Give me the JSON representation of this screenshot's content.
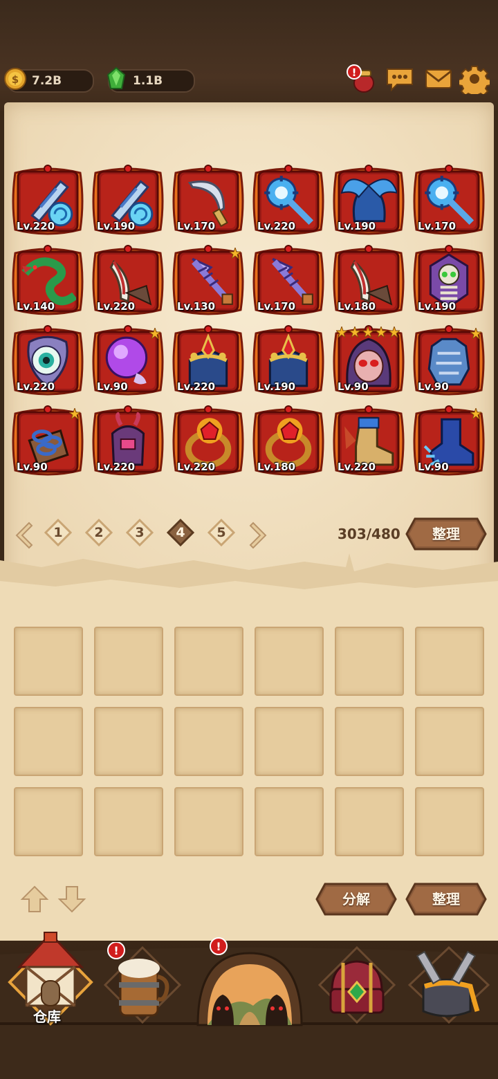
{
  "resources": {
    "gold": "7.2B",
    "gems": "1.1B"
  },
  "top_icons": [
    "quest-bag-icon",
    "chat-icon",
    "mail-icon",
    "settings-gear-icon"
  ],
  "equipment": {
    "items": [
      {
        "name": "sword",
        "level": "Lv.220",
        "stars": 0
      },
      {
        "name": "sword",
        "level": "Lv.190",
        "stars": 0
      },
      {
        "name": "scimitar",
        "level": "Lv.170",
        "stars": 0
      },
      {
        "name": "mace",
        "level": "Lv.220",
        "stars": 0
      },
      {
        "name": "helmet-wings",
        "level": "Lv.190",
        "stars": 0
      },
      {
        "name": "mace",
        "level": "Lv.170",
        "stars": 0
      },
      {
        "name": "serpent",
        "level": "Lv.140",
        "stars": 0
      },
      {
        "name": "claw-blade",
        "level": "Lv.220",
        "stars": 0
      },
      {
        "name": "spear",
        "level": "Lv.130",
        "stars": 1
      },
      {
        "name": "spear",
        "level": "Lv.170",
        "stars": 0
      },
      {
        "name": "claw-blade",
        "level": "Lv.180",
        "stars": 0
      },
      {
        "name": "skull-shield",
        "level": "Lv.190",
        "stars": 0
      },
      {
        "name": "eye-shield",
        "level": "Lv.220",
        "stars": 0
      },
      {
        "name": "orb",
        "level": "Lv.90",
        "stars": 1
      },
      {
        "name": "crown-helm",
        "level": "Lv.220",
        "stars": 0
      },
      {
        "name": "crown-helm",
        "level": "Lv.190",
        "stars": 0
      },
      {
        "name": "skull-hood",
        "level": "Lv.90",
        "stars": 5
      },
      {
        "name": "armor",
        "level": "Lv.90",
        "stars": 1
      },
      {
        "name": "chain-gloves",
        "level": "Lv.90",
        "stars": 1
      },
      {
        "name": "demon-gloves",
        "level": "Lv.220",
        "stars": 0
      },
      {
        "name": "fire-ring",
        "level": "Lv.220",
        "stars": 0
      },
      {
        "name": "fire-ring",
        "level": "Lv.180",
        "stars": 0
      },
      {
        "name": "boots",
        "level": "Lv.220",
        "stars": 0
      },
      {
        "name": "ice-boots",
        "level": "Lv.90",
        "stars": 1
      }
    ]
  },
  "pager": {
    "pages": [
      "1",
      "2",
      "3",
      "4",
      "5"
    ],
    "current": "4"
  },
  "capacity": "303/480",
  "buttons": {
    "sort_top": "整理",
    "dismantle": "分解",
    "sort_bottom": "整理"
  },
  "bottom_nav": {
    "warehouse_label": "仓库"
  },
  "colors": {
    "frame_red": "#b8231a",
    "frame_orange": "#e8701c",
    "parchment": "#f3e3c2",
    "button_brown": "#8a5a3a"
  }
}
